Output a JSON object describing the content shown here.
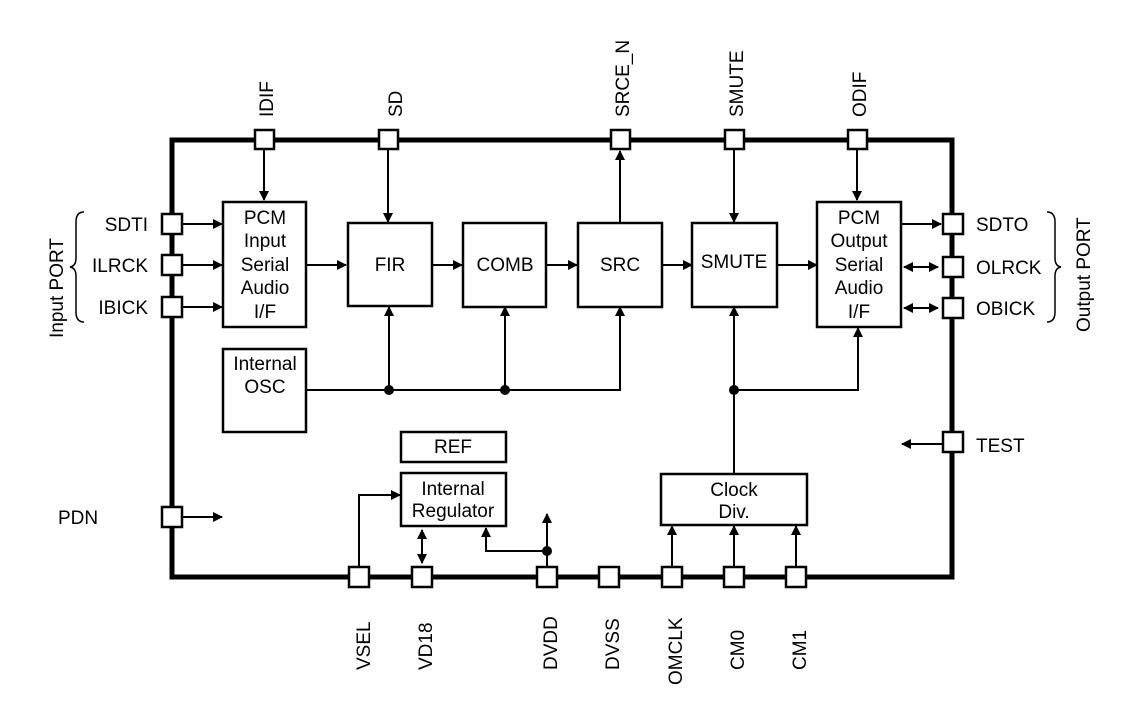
{
  "diagram": {
    "ports": {
      "input_group": "Input PORT",
      "output_group": "Output PORT"
    },
    "pins": {
      "top": [
        "IDIF",
        "SD",
        "SRCE_N",
        "SMUTE",
        "ODIF"
      ],
      "left": [
        "SDTI",
        "ILRCK",
        "IBICK",
        "PDN"
      ],
      "right": [
        "SDTO",
        "OLRCK",
        "OBICK",
        "TEST"
      ],
      "bottom": [
        "VSEL",
        "VD18",
        "DVDD",
        "DVSS",
        "OMCLK",
        "CM0",
        "CM1"
      ]
    },
    "blocks": {
      "pcm_in": [
        "PCM",
        "Input",
        "Serial",
        "Audio",
        "I/F"
      ],
      "fir": "FIR",
      "comb": "COMB",
      "src": "SRC",
      "smute": "SMUTE",
      "pcm_out": [
        "PCM",
        "Output",
        "Serial",
        "Audio",
        "I/F"
      ],
      "osc": [
        "Internal",
        "OSC"
      ],
      "ref": "REF",
      "regulator": [
        "Internal",
        "Regulator"
      ],
      "clkdiv": [
        "Clock",
        "Div."
      ]
    }
  }
}
